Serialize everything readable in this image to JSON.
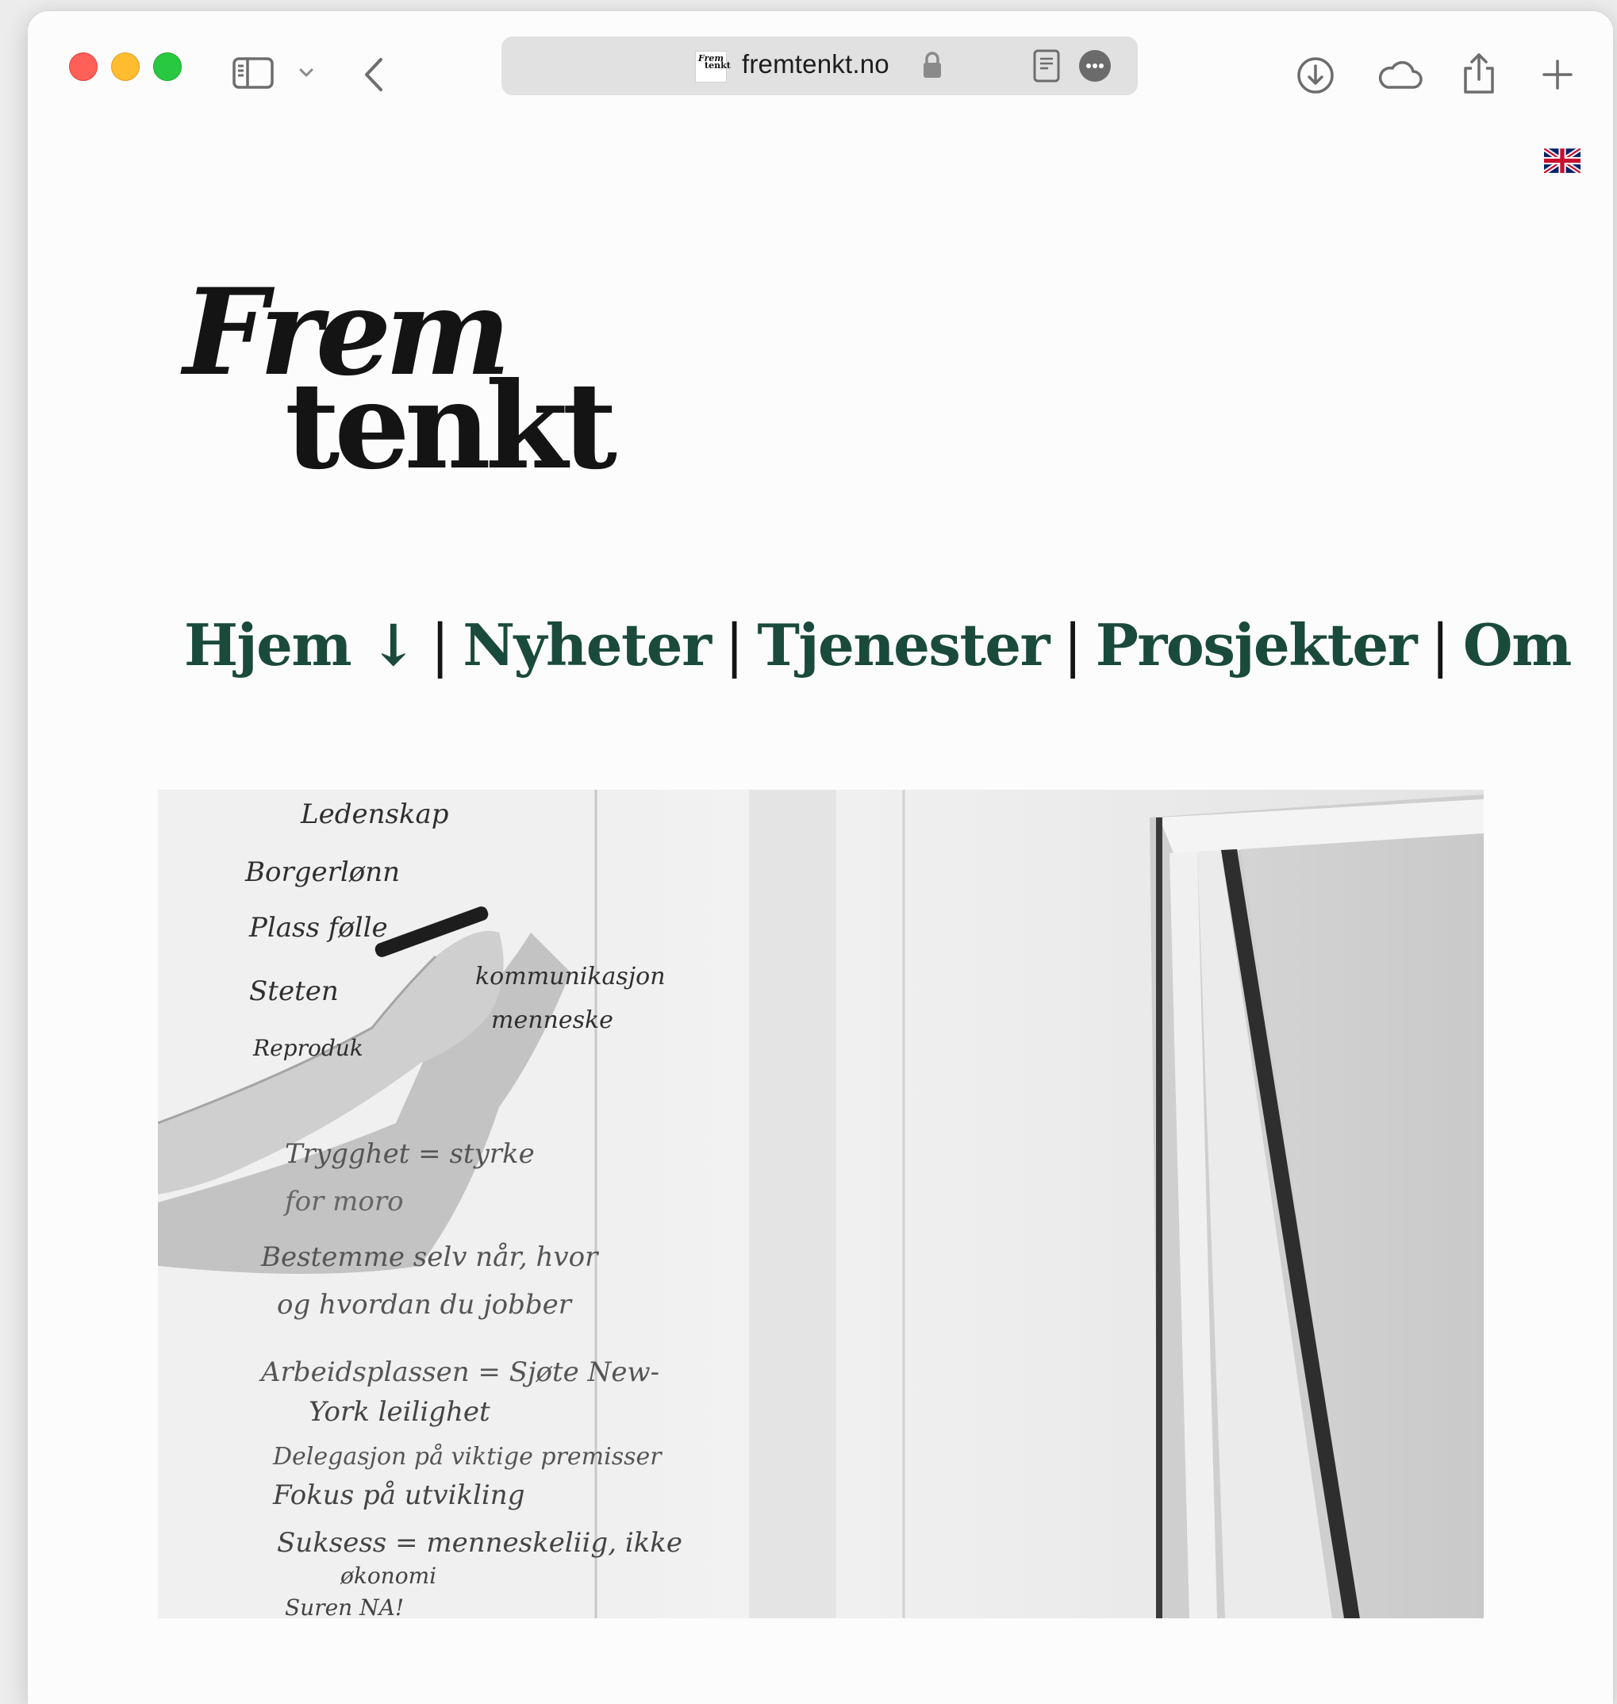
{
  "browser": {
    "url": "fremtenkt.no",
    "favicon_text": [
      "Frem",
      "tenkt"
    ]
  },
  "site": {
    "logo_line1": "Frem",
    "logo_line2": "tenkt",
    "language_flag": "uk-flag-icon"
  },
  "nav": {
    "items": [
      {
        "label": "Hjem ↓"
      },
      {
        "label": "Nyheter"
      },
      {
        "label": "Tjenester"
      },
      {
        "label": "Prosjekter"
      },
      {
        "label": "Om"
      }
    ],
    "separator": "|"
  },
  "hero": {
    "alt": "Black and white photo of a hand writing on a whiteboard",
    "whiteboard_lines": [
      "Ledenskap",
      "Borgerlønn",
      "Plass følle",
      "Steten",
      "kommunikasjon",
      "Reproduk",
      "menneske",
      "Trygghet = styrke",
      "for moro",
      "Bestemme selv når, hvor",
      "og hvordan du jobber",
      "Arbeidsplassen = Sjøte New-",
      "York leilighet",
      "Delegasjon på viktige premisser",
      "Fokus på utvikling",
      "Suksess = menneskeliig, ikke",
      "økonomi",
      "Suren NA!"
    ]
  },
  "colors": {
    "nav_link": "#1a4a3b",
    "logo": "#141414",
    "page_bg": "#fcfcfc"
  }
}
